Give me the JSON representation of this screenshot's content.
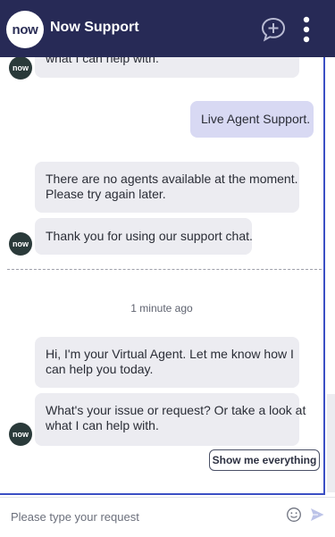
{
  "header": {
    "logo_text": "now",
    "title": "Now Support",
    "new_chat_icon": "chat-plus-icon",
    "menu_icon": "more-vertical-icon",
    "color": "#272a56"
  },
  "messages": [
    {
      "from": "agent",
      "lines": [
        "what I can help with."
      ]
    },
    {
      "from": "user",
      "lines": [
        "Live Agent Support."
      ]
    },
    {
      "from": "agent",
      "lines": [
        "There are no agents available at the moment.",
        "Please try again later."
      ]
    },
    {
      "from": "agent",
      "lines": [
        "Thank you for using our support chat."
      ]
    },
    {
      "from": "agent",
      "lines": [
        "Hi, I'm your Virtual Agent. Let me know how I",
        "can help you today."
      ]
    },
    {
      "from": "agent",
      "lines": [
        "What's your issue or request? Or take a look at",
        "what I can help with."
      ]
    }
  ],
  "avatar_text": "now",
  "timestamp": "1 minute ago",
  "suggestion_button": "Show me everything",
  "composer": {
    "placeholder": "Please type your request",
    "emoji_icon": "smiley-icon",
    "send_icon": "send-icon"
  },
  "accent": "#3b4fc4"
}
